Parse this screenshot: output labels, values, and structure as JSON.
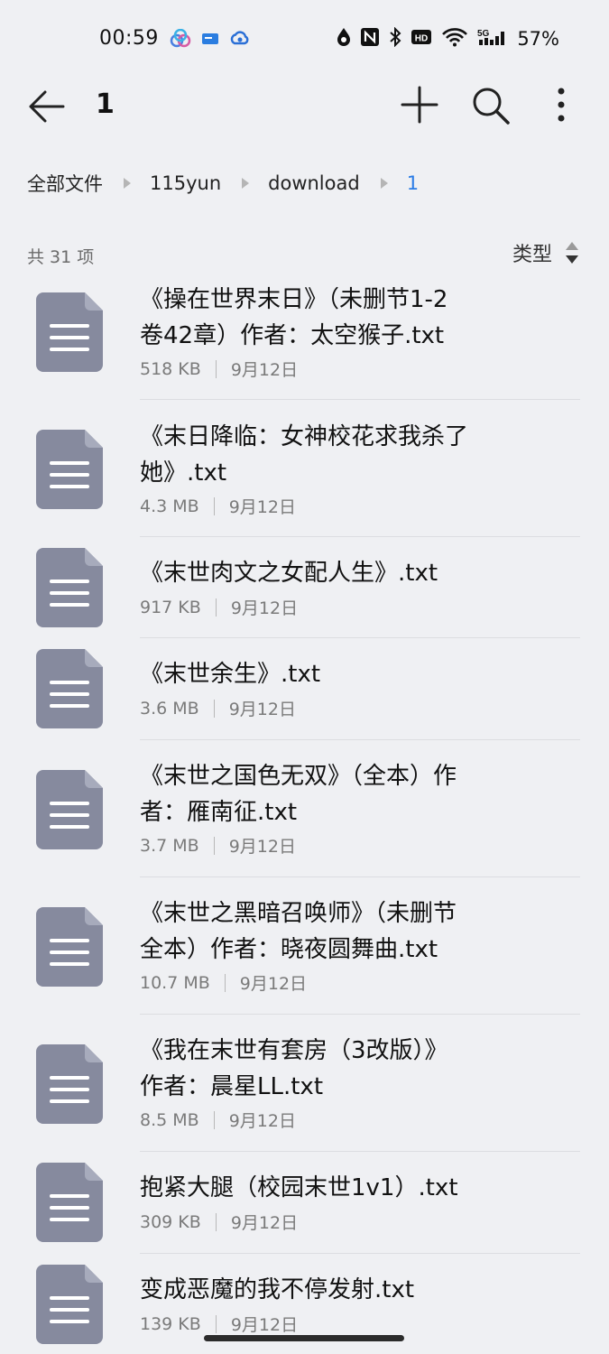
{
  "status_bar": {
    "time": "00:59",
    "battery": "57%",
    "icons_left": [
      "app-notification-icon",
      "message-icon",
      "cloud-icon"
    ],
    "icons_right": [
      "location-icon",
      "nfc-icon",
      "bluetooth-icon",
      "hd-icon",
      "wifi-icon",
      "signal-5g-icon"
    ]
  },
  "app_bar": {
    "title": "1",
    "icons": [
      "back-arrow-icon",
      "plus-icon",
      "search-icon",
      "more-vertical-icon"
    ]
  },
  "breadcrumb": [
    "全部文件",
    "115yun",
    "download",
    "1"
  ],
  "list_header": {
    "count": "共 31 项",
    "sort_label": "类型"
  },
  "files": [
    {
      "name_lines": [
        "《操在世界末日》（未删节1-2",
        "卷42章）作者：太空猴子.txt"
      ],
      "size": "518 KB",
      "date": "9月12日"
    },
    {
      "name_lines": [
        "《末日降临：女神校花求我杀了",
        "她》.txt"
      ],
      "size": "4.3 MB",
      "date": "9月12日"
    },
    {
      "name_lines": [
        "《末世肉文之女配人生》.txt"
      ],
      "size": "917 KB",
      "date": "9月12日"
    },
    {
      "name_lines": [
        "《末世余生》.txt"
      ],
      "size": "3.6 MB",
      "date": "9月12日"
    },
    {
      "name_lines": [
        "《末世之国色无双》（全本）作",
        "者：雁南征.txt"
      ],
      "size": "3.7 MB",
      "date": "9月12日"
    },
    {
      "name_lines": [
        "《末世之黑暗召唤师》（未删节",
        "全本）作者：晓夜圆舞曲.txt"
      ],
      "size": "10.7 MB",
      "date": "9月12日"
    },
    {
      "name_lines": [
        "《我在末世有套房（3改版）》",
        "作者：晨星LL.txt"
      ],
      "size": "8.5 MB",
      "date": "9月12日"
    },
    {
      "name_lines": [
        "抱紧大腿（校园末世1v1）.txt"
      ],
      "size": "309 KB",
      "date": "9月12日"
    },
    {
      "name_lines": [
        "变成恶魔的我不停发射.txt"
      ],
      "size": "139 KB",
      "date": "9月12日"
    }
  ],
  "colors": {
    "background": "#eff0f3",
    "accent": "#2a7ce6",
    "file_icon": "#868a9e"
  }
}
